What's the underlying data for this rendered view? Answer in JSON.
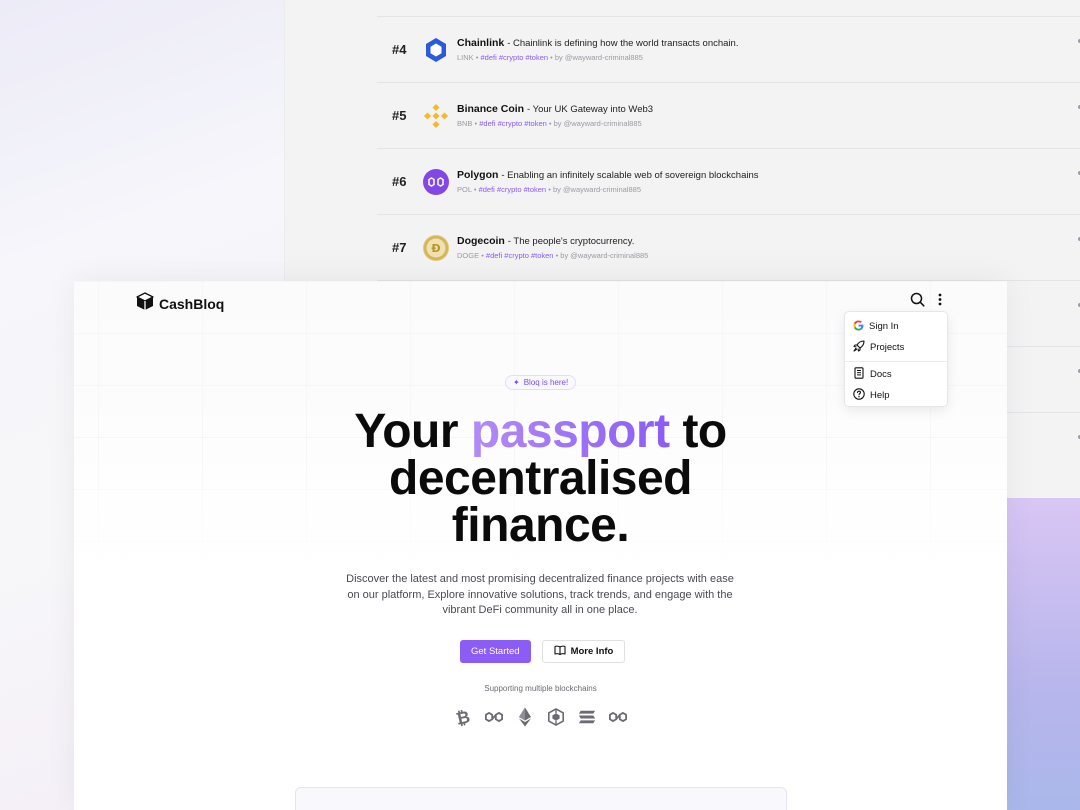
{
  "rankings": [
    {
      "rank": "#4",
      "name": "Chainlink",
      "description": "- Chainlink is defining how the world transacts onchain.",
      "symbol": "LINK",
      "tags": "#defi #crypto #token",
      "author": "by @wayward-criminal885",
      "logo": "chainlink-icon",
      "color": "#2a5ada"
    },
    {
      "rank": "#5",
      "name": "Binance Coin",
      "description": "- Your UK Gateway into Web3",
      "symbol": "BNB",
      "tags": "#defi #crypto #token",
      "author": "by @wayward-criminal885",
      "logo": "binance-icon",
      "color": "#f3ba2f"
    },
    {
      "rank": "#6",
      "name": "Polygon",
      "description": "- Enabling an infinitely scalable web of sovereign blockchains",
      "symbol": "POL",
      "tags": "#defi #crypto #token",
      "author": "by @wayward-criminal885",
      "logo": "polygon-icon",
      "color": "#8247e5"
    },
    {
      "rank": "#7",
      "name": "Dogecoin",
      "description": "- The people's cryptocurrency.",
      "symbol": "DOGE",
      "tags": "#defi #crypto #token",
      "author": "by @wayward-criminal885",
      "logo": "dogecoin-icon",
      "color": "#c2a633"
    }
  ],
  "separator": "•",
  "header": {
    "brand": "CashBloq",
    "brand_icon": "cube-icon",
    "search_icon": "search-icon",
    "more_icon": "vertical-dots-icon"
  },
  "menu": {
    "items": [
      {
        "label": "Sign In",
        "icon": "google-icon"
      },
      {
        "label": "Projects",
        "icon": "rocket-icon"
      },
      {
        "label": "Docs",
        "icon": "document-icon"
      },
      {
        "label": "Help",
        "icon": "help-circle-icon"
      }
    ]
  },
  "hero": {
    "badge": "Bloq is here!",
    "headline_1": "Your",
    "headline_accent": "passport",
    "headline_2": "to",
    "headline_3": "decentralised",
    "headline_4": "finance.",
    "subtext": "Discover the latest and most promising decentralized finance projects with ease on our platform, Explore innovative solutions, track trends, and engage with the vibrant DeFi community all in one place.",
    "primary_cta": "Get Started",
    "secondary_cta": "More Info",
    "support_label": "Supporting multiple blockchains",
    "chains": [
      "bitcoin-icon",
      "polygon-icon",
      "ethereum-icon",
      "bnb-icon",
      "solana-icon",
      "polygon-icon"
    ]
  },
  "colors": {
    "accent": "#8b5cf6",
    "accent_light": "#b28cf5",
    "text": "#0b0b0c",
    "muted": "#9a9aa3"
  }
}
